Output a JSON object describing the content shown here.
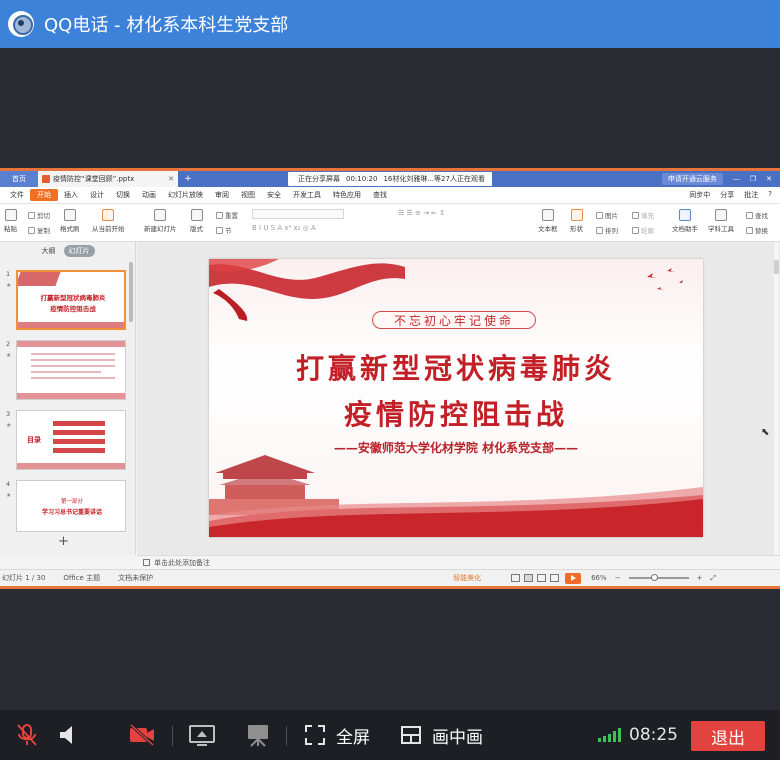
{
  "window": {
    "title": "QQ电话 - 材化系本科生党支部"
  },
  "wps": {
    "tabs": {
      "home": "首页",
      "file": "疫情防控“课堂回顾”.pptx",
      "plus": "+"
    },
    "share_notice": {
      "status": "正在分享屏幕",
      "time": "00:10:20",
      "viewers": "16材化刘雅琳...等27人正在观看"
    },
    "right": {
      "login": "申请开通云服务"
    },
    "menu": [
      "文件",
      "开始",
      "插入",
      "设计",
      "切换",
      "动画",
      "幻灯片放映",
      "审阅",
      "视图",
      "安全",
      "开发工具",
      "特色应用",
      "查找"
    ],
    "menu_right": [
      "同步中",
      "分享",
      "批注",
      "?"
    ],
    "ribbon": {
      "paste": "粘贴",
      "cut": "剪切",
      "copy": "复制",
      "format": "格式刷",
      "from_current": "从当前开始",
      "new_slide": "新建幻灯片",
      "layout": "版式",
      "section": "节",
      "reset": "重置",
      "textbox": "文本框",
      "shape": "形状",
      "arrange": "排列",
      "picture": "图片",
      "fill": "填充",
      "outline": "轮廓",
      "doc_assist": "文档助手",
      "subject_tools": "学科工具",
      "find": "查找",
      "replace": "替换"
    }
  },
  "left_panel": {
    "tab_outline": "大纲",
    "tab_slides": "幻灯片",
    "thumbs": [
      {
        "num": "1",
        "line1": "打赢新型冠状病毒肺炎",
        "line2": "疫情防控阻击战"
      },
      {
        "num": "2"
      },
      {
        "num": "3",
        "label": "目录"
      },
      {
        "num": "4",
        "line1": "第一部分",
        "line2": "学习习总书记重要讲话"
      }
    ],
    "add": "+"
  },
  "slide": {
    "tag": "不忘初心牢记使命",
    "title_line1": "打赢新型冠状病毒肺炎",
    "title_line2": "疫情防控阻击战",
    "subtitle": "——安徽师范大学化材学院 材化系党支部——"
  },
  "notes_hint": "单击此处添加备注",
  "status": {
    "slide_count": "幻灯片 1 / 30",
    "theme": "Office 主题",
    "protect": "文档未保护",
    "beautify": "智能美化",
    "zoom": "66%"
  },
  "toolbar": {
    "fullscreen": "全屏",
    "pip": "画中画",
    "time": "08:25",
    "exit": "退出"
  },
  "colors": {
    "title_bar": "#3c82d9",
    "accent_orange": "#e8743b",
    "slide_red": "#c21f26",
    "exit_red": "#e2433f",
    "signal_green": "#3fc15a"
  }
}
